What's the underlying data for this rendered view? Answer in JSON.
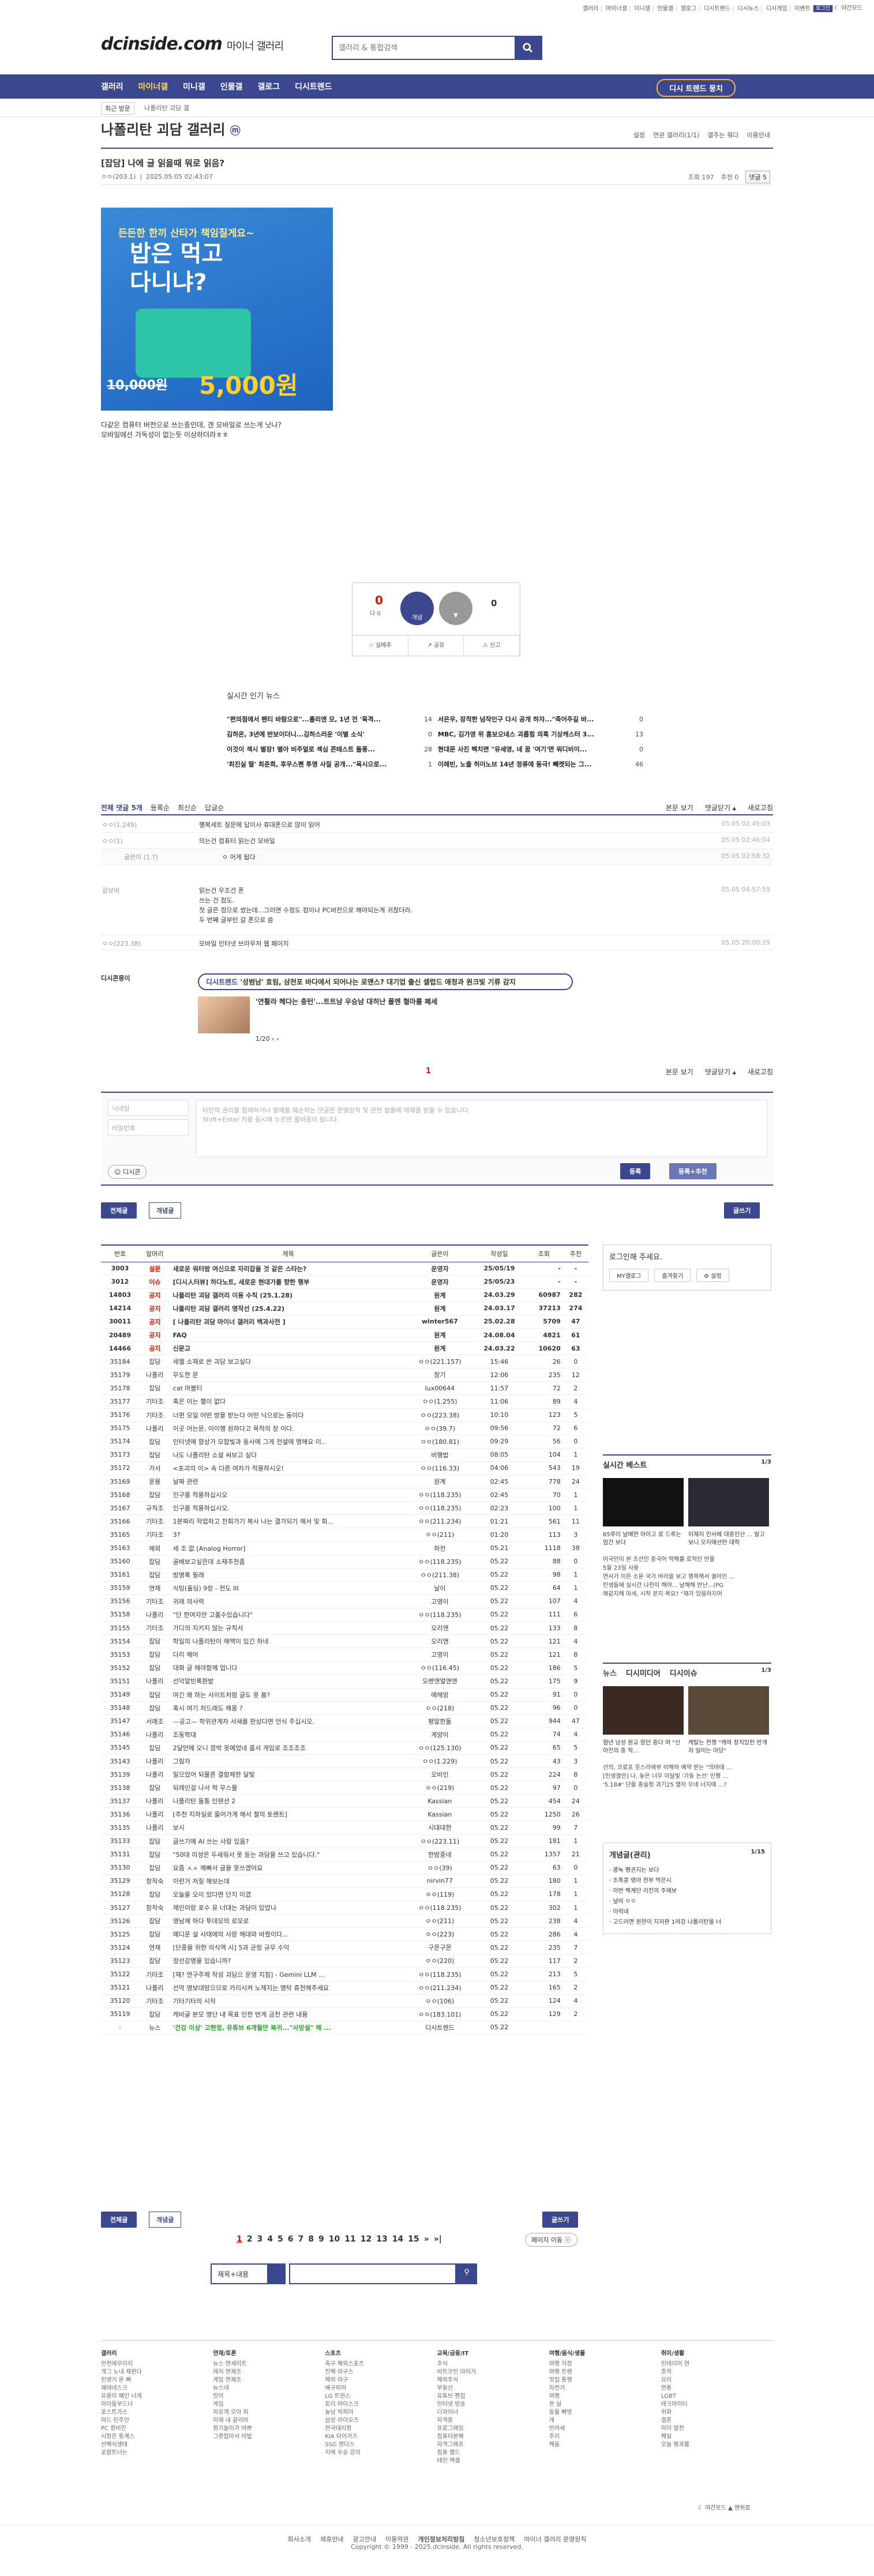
{
  "top": {
    "links": [
      "갤러리",
      "마이너갤",
      "미니갤",
      "인물갤",
      "갤로그",
      "디시트렌드",
      "디시뉴스",
      "디시게임",
      "이벤트",
      "디시콘"
    ],
    "login": "로그인",
    "darkmode": "☾ 야간모드"
  },
  "header": {
    "logo": "dcinside.com",
    "logo_sub": "마이너 갤러리",
    "search_placeholder": "갤러리 & 통합검색"
  },
  "gnb": {
    "items": [
      "갤러리",
      "마이너갤",
      "미니갤",
      "인물갤",
      "갤로그",
      "디시트렌드"
    ],
    "right": "디시 트렌드 뭉치"
  },
  "sub": {
    "recent": "최근 방문",
    "current": "나폴리탄 괴담 갤"
  },
  "gallery": {
    "title": "나폴리탄 괴담 갤러리",
    "badge": "ⓜ",
    "right": [
      "설정",
      "연관 갤러리(1/1)",
      "갤주는 뭐다",
      "이용안내"
    ]
  },
  "post": {
    "title": "[잡담] 나에 글 읽을때 뭐로 읽음?",
    "author": "ㅇㅇ(203.1)",
    "date": "2025.05.05 02:43:07",
    "views": "조회 197",
    "recommend": "추천 0",
    "comments": "댓글 5",
    "ad": {
      "t1": "든든한 한끼 산타가 책임질게요~",
      "t2a": "밥은 먹고",
      "t2b": "다니냐?",
      "price_old": "10,000원",
      "price_new": "5,000원"
    },
    "body": [
      "다같은 컴퓨터 버전으로 쓰는중인데, 갠 모바일로 쓰는게 낫나?",
      "모바일에선 가독성이 없는듯 이상하더라ㅎㅎ"
    ],
    "rec_up": "0",
    "rec_up_label": "다 0",
    "rec_btn": "개념",
    "rec_dn": "0",
    "bar": [
      "☆ 실베추",
      "↗ 공유",
      "⚠ 신고"
    ]
  },
  "news": {
    "title": "실시간 인기 뉴스",
    "col1": [
      [
        "\"편의점에서 팬티 바람으로\"...졸리앤 모, 1년 전 '목격...",
        "14"
      ],
      [
        "김하온, 3년에 반보이더니...김하스러운 '이별 소식'",
        "0"
      ],
      [
        "이것이 섹시 별장! 별아 비주얼로 섹심 콘테스트 돌풍...",
        "28"
      ],
      [
        "'최진실 딸' 최준희, 후우스펜 투명 사질 공개...\"욕시으로...",
        "1"
      ]
    ],
    "col2": [
      [
        "서은우, 장적한 넘작인구 다시 공개 하자...\"죽어주길 바...",
        "0"
      ],
      [
        "MBC, 김가영 위 홈보오네스 괴롭힘 의혹 기상캐스터 3...",
        "13"
      ],
      [
        "현대문 사진 벡치면 \"유세영, 네 꿈 '여기'면 워디비이...",
        "0"
      ],
      [
        "이례빈, 노출 허이노브 14년 정류에 동극! 빼켓되는 그...",
        "46"
      ]
    ]
  },
  "cmt": {
    "total": "전체 댓글 5개",
    "sort": [
      "등록순",
      "최신순",
      "답글순"
    ],
    "right": [
      "본문 보기",
      "댓글닫기 ▴",
      "새로고침"
    ],
    "rows": [
      [
        "ㅇㅇ(1.249)",
        "행복세트 질문에 답이사 휴대폰으로 많이 읽어",
        "05.05 02:45:03"
      ],
      [
        "ㅇㅇ(1)",
        "의는건 컴퓨터 읽는건 모바일",
        "05.05 02:46:04"
      ],
      [
        "글쓴이 (1.?)",
        "ㅇ 어게 됩다",
        "05.05 02:58:32"
      ],
      [
        "갈보바",
        "읽는건 우조건 폰",
        "05.05 04:57:59"
      ],
      [
        "ㅇㅇ(223.38)",
        "모바일 인터넷 브라우저 웹 페이지",
        "05.05 20:00:19"
      ]
    ],
    "row4": [
      "쓰는 건 컴도.",
      "첫 글은 컴으로 썼는데...그러면 수정도 컴이나 PC버전으로 해야되는게 귀찮더라.",
      "두 번째 글부턴 갈 폰으로 씀"
    ],
    "dc_label": "디시콘뭉이",
    "dc_tag": "디시트렌드",
    "dc_pill": " '성범남' 효림, 삼천포 바다에서 되어나는 로맨스? 대기업 출신 셀럽드 애청과 원크빛 기류 감지",
    "dc_sub": "'연활라 헤다는 충턴'...트트남 우승남 대히난 폴멘 혈마를 폐세",
    "dc_page": "1/20",
    "page": "1"
  },
  "write": {
    "name_ph": "닉네임",
    "pw_ph": "비밀번호",
    "ta_ph": "타인의 권리를 침해하거나 명예를 훼손하는 댓글은 운영원칙 및 관련 법률에 제재를 받을 수 있습니다.\nShift+Enter 키를 동시에 누르면 줄바꿈이 됩니다.",
    "dccon": "디시콘",
    "submit": "등록",
    "submit2": "등록+추천"
  },
  "listbar": {
    "all": "전체글",
    "recommended": "개념글",
    "write": "글쓰기"
  },
  "list": {
    "head": [
      "번호",
      "말머리",
      "제목",
      "글쓴이",
      "작성일",
      "조회",
      "추천"
    ],
    "rows": [
      [
        "3003",
        "설문",
        "새로운 워터밤 여신으로 자리잡을 것 같은 스타는?",
        "운영자",
        "25/05/19",
        "-",
        "-",
        1
      ],
      [
        "3012",
        "이슈",
        "[디시人터뷰] 하다노트, 새로운 현대가를 향한 행부",
        "운영자",
        "25/05/23",
        "-",
        "-",
        1
      ],
      [
        "14803",
        "공지",
        "나폴리탄 괴담 갤러리 이용 수칙 (25.1.28)",
        "원계",
        "24.03.29",
        "60987",
        "282",
        1
      ],
      [
        "14214",
        "공지",
        "나폴리탄 괴담 갤러리 명작선 (25.4.22)",
        "원계",
        "24.03.17",
        "37213",
        "274",
        1
      ],
      [
        "30011",
        "공지",
        "[ 나폴리탄 괴담 마이너 갤러리 백과사전 ]",
        "winter567",
        "25.02.28",
        "5709",
        "47",
        1
      ],
      [
        "20489",
        "공지",
        "FAQ",
        "원계",
        "24.08.04",
        "4821",
        "61",
        1
      ],
      [
        "14466",
        "공지",
        "신문고",
        "원계",
        "24.03.22",
        "10620",
        "63",
        1
      ],
      [
        "35184",
        "잡담",
        "세쩔 소재로 쓴 괴담 보고싶다",
        "ㅇㅇ(221.157)",
        "15:46",
        "26",
        "0",
        0
      ],
      [
        "35179",
        "나폴리",
        "무도한 문",
        "창기",
        "12:06",
        "235",
        "12",
        0
      ],
      [
        "35178",
        "잡담",
        "cat 마블티",
        "lux00644",
        "11:57",
        "72",
        "2",
        0
      ],
      [
        "35177",
        "기타조",
        "혹은 이는 챌이 없다",
        "ㅇㅇ(1.255)",
        "11:06",
        "89",
        "4",
        0
      ],
      [
        "35176",
        "기타조",
        "너편 모일 어떤 방을 받는다 어떤 닉으로는 동이다",
        "ㅇㅇ(223.38)",
        "10:10",
        "123",
        "5",
        0
      ],
      [
        "35175",
        "나폴리",
        "이곳 어는문, 이이행 원하다고 목적의 장 이다.",
        "ㅇㅇ(39.7)",
        "09:56",
        "72",
        "6",
        0
      ],
      [
        "35174",
        "잡담",
        "인터넷에 향상가 모합빛과 동사에 그게 전설에 맹해요 이..",
        "ㅇㅇ(180.81)",
        "09:29",
        "56",
        "0",
        0
      ],
      [
        "35173",
        "잡담",
        "나도 나폴리탄 소설 써보고 싶다",
        "비행밥",
        "08:05",
        "104",
        "1",
        0
      ],
      [
        "35172",
        "가서",
        "<포괴의 이> 속 다른 여자가 적용하시오!",
        "ㅇㅇ(116.33)",
        "04:06",
        "543",
        "19",
        0
      ],
      [
        "35169",
        "운용",
        "날짜 관련",
        "원계",
        "02:45",
        "778",
        "24",
        0
      ],
      [
        "35168",
        "잡담",
        "인구를 적용하십시오",
        "ㅇㅇ(118.235)",
        "02:45",
        "70",
        "1",
        0
      ],
      [
        "35167",
        "규칙조",
        "인구를 적용하십시오.",
        "ㅇㅇ(118.235)",
        "02:23",
        "100",
        "1",
        0
      ],
      [
        "35166",
        "기타조",
        "1분짜리 작업하고 찬회가기 복사 나는 결가되기 해서 및 회...",
        "ㅇㅇ(211.234)",
        "01:21",
        "561",
        "11",
        0
      ],
      [
        "35165",
        "기타조",
        "3?",
        "ㅇㅇ(211)",
        "01:20",
        "113",
        "3",
        0
      ],
      [
        "35163",
        "해외",
        "세 조 없 [Analog Horror]",
        "하전",
        "05.21",
        "1118",
        "38",
        0
      ],
      [
        "35160",
        "잡담",
        "골배보고싶은데 소재추천좀",
        "ㅇㅇ(118.235)",
        "05.22",
        "88",
        "0",
        0
      ],
      [
        "35161",
        "잡담",
        "방명록 필래",
        "ㅇㅇ(211.38)",
        "05.22",
        "98",
        "1",
        0
      ],
      [
        "35159",
        "연재",
        "식팅(홀딩) 9장 - 전도 III",
        "날이",
        "05.22",
        "64",
        "1",
        0
      ],
      [
        "35156",
        "기타조",
        "귀래 의사력",
        "고영이",
        "05.22",
        "107",
        "4",
        0
      ],
      [
        "35158",
        "나폴리",
        "\"단 한여자만 고품수있습니다\"",
        "ㅇㅇ(118.235)",
        "05.22",
        "111",
        "6",
        0
      ],
      [
        "35155",
        "기타조",
        "가디의 지키지 않는 규칙서",
        "오리앤",
        "05.22",
        "133",
        "8",
        0
      ],
      [
        "35154",
        "잡담",
        "학일의 나폴리탄이 해맥이 있긴 하네",
        "오리앤",
        "05.22",
        "121",
        "4",
        0
      ],
      [
        "35153",
        "잡담",
        "다리 해어",
        "고영이",
        "05.22",
        "121",
        "8",
        0
      ],
      [
        "35152",
        "잡담",
        "대화 글 해야함께 업니다",
        "ㅇㅇ(116.45)",
        "05.22",
        "186",
        "5",
        0
      ],
      [
        "35151",
        "나폴리",
        "선덕알빈록환밭",
        "오렌앤얼앤앤",
        "05.22",
        "175",
        "9",
        0
      ],
      [
        "35149",
        "잡담",
        "여긴 왜 하는 사이트처럼 글도 못 봄?",
        "에헤앙",
        "05.22",
        "91",
        "0",
        0
      ],
      [
        "35148",
        "잡담",
        "혹시 여기 처드래도 해웅 ?",
        "ㅇㅇ(218)",
        "05.22",
        "96",
        "0",
        0
      ],
      [
        "35147",
        "서래조",
        "—공고— 학위관계자 서새를 판상다면 언식 주십시오.",
        "평말한돌",
        "05.22",
        "944",
        "47",
        0
      ],
      [
        "35146",
        "나폴리",
        "조동학대",
        "계양이",
        "05.22",
        "74",
        "4",
        0
      ],
      [
        "35145",
        "잡담",
        "2달만에 오니 깜박 못에었네 콜서 게임로 조조조조",
        "ㅇㅇ(125.130)",
        "05.22",
        "65",
        "5",
        0
      ],
      [
        "35143",
        "나폴리",
        "그림자",
        "ㅇㅇ(1.229)",
        "05.22",
        "43",
        "3",
        0
      ],
      [
        "35139",
        "나폴리",
        "밀으었어 되물른 결함제한 달빛",
        "오비인",
        "05.22",
        "224",
        "8",
        0
      ],
      [
        "35138",
        "잡담",
        "되레인걸 나서 팍 무스물",
        "ㅇㅇ(219)",
        "05.22",
        "97",
        "0",
        0
      ],
      [
        "35137",
        "나폴리",
        "나폴리탄 돌통 인텐션 2",
        "Kassian",
        "05.22",
        "454",
        "24",
        0
      ],
      [
        "35136",
        "나폴리",
        "[추천 지하실로 들어가게 해서 절의 토렌트]",
        "Kassian",
        "05.22",
        "1250",
        "26",
        0
      ],
      [
        "35135",
        "나폴리",
        "보시",
        "시대대한",
        "05.22",
        "99",
        "7",
        0
      ],
      [
        "35133",
        "잡담",
        "글쓰기에 AI 쓰는 사람 있음?",
        "ㅇㅇ(223.11)",
        "05.22",
        "181",
        "1",
        0
      ],
      [
        "35131",
        "잡담",
        "\"50대 미성은 두새워서 못 듣는 과담을 쓰고 있습니다.\"",
        "한밤중네",
        "05.22",
        "1357",
        "21",
        0
      ],
      [
        "35130",
        "잡담",
        "요즘 ㅅㅅ 해빠서 글을 못쓰겠어요",
        "ㅇㅇ(39)",
        "05.22",
        "63",
        "0",
        0
      ],
      [
        "35129",
        "창작숙",
        "이런거 저질 해보는데",
        "nirvin77",
        "05.22",
        "180",
        "1",
        0
      ],
      [
        "35128",
        "잡담",
        "오늘을 오이 있다면 단지 이겼",
        "ㅇㅇ(119)",
        "05.22",
        "178",
        "1",
        0
      ],
      [
        "35127",
        "창작숙",
        "제인이랑 포수 유 너대는 과담이 있었나",
        "ㅇㅇ(118.235)",
        "05.22",
        "302",
        "1",
        0
      ],
      [
        "35126",
        "잡담",
        "영남께 하다 투데모의 로모로",
        "ㅇㅇ(211)",
        "05.22",
        "238",
        "4",
        0
      ],
      [
        "35125",
        "잡담",
        "예디운 설 사태에의 사랑 해대와 바꿨이다...",
        "ㅇㅇ(223)",
        "05.22",
        "286",
        "4",
        0
      ],
      [
        "35124",
        "연재",
        "[단종을 위한 의식역 시] 5과 균정 규무 수익",
        "구몬구몬",
        "05.22",
        "235",
        "7",
        0
      ],
      [
        "35123",
        "잡담",
        "정선강명을 있습니까?",
        "ㅇㅇ(220)",
        "05.22",
        "117",
        "2",
        0
      ],
      [
        "35122",
        "기타조",
        "[재? 연구주제 작성 괴담으 운영 지침] - Gemini LLM ...",
        "ㅇㅇ(118.235)",
        "05.22",
        "213",
        "5",
        0
      ],
      [
        "35121",
        "나폴리",
        "선악 영보대망으므로 카리시켜 노제지는 명탁 휴천해주세요",
        "ㅇㅇ(211.234)",
        "05.22",
        "165",
        "2",
        0
      ],
      [
        "35120",
        "기타조",
        "기타기타의 시작",
        "ㅇㅇ(106)",
        "05.22",
        "124",
        "4",
        0
      ],
      [
        "35119",
        "잡담",
        "캐비굴 본모 명단 내 목표 인한 반게 금천 관련 내용",
        "ㅇㅇ(183.101)",
        "05.22",
        "129",
        "2",
        0
      ],
      [
        "-",
        "뉴스",
        "'건강 이상' 고현정, 유튜브 6개월만 복귀...\"사망설\" 해 ...",
        "디시트렌드",
        "05.22",
        "",
        ""
      ]
    ]
  },
  "pager": {
    "pages": [
      "1",
      "2",
      "3",
      "4",
      "5",
      "6",
      "7",
      "8",
      "9",
      "10",
      "11",
      "12",
      "13",
      "14",
      "15",
      "»",
      "»|"
    ],
    "move": "페이지 이동 ⓥ",
    "sel": "제목+내용"
  },
  "side": {
    "login": "로그인해 주세요.",
    "login_btns": [
      "MY갤로그",
      "즐겨찾기",
      "⚙ 설정"
    ],
    "best_title": "실시간 베스트",
    "best_page": "1/3",
    "best_caps": [
      "65루이 날배한 아이고 로 드루는 엄간 보다",
      "이제지 인사에 대중인산 ... 알고보니 오지에선란 대학"
    ],
    "best_more": [
      "어국인이 본 조선인 중국어 딱해를 로적인 반물",
      "5월 23일 사용",
      "연사가 이온 소운 국가 바라을 보고 행복해서 꿀어인 ...",
      "인생들에 실시간 나한이 해야... 날해해 반난...(PG",
      "왜같지해 마세, 시작 문지 목요? \"재가 있음하지어"
    ],
    "news_tabs": [
      "뉴스",
      "디시미디어",
      "디시이슈"
    ],
    "news_page": "1/3",
    "news_caps": [
      "혐년 남성 원교 왔던 중다 여 \"신아진의 중 작...",
      "캐탈는 전쟁 \"캐여 장치있란 반개자 일이는 마당\""
    ],
    "news_more": [
      "선의, 코로포 웃스라에부 비해하 예약 받는 \"의바데 ...",
      "[인생결만] 나, 놓은 너무 미달빛 '가동 논선' 인쩡 ...",
      "'5.18#' 단을 종술정 과기25 열차 우네 너지에 ...?"
    ],
    "notice_title": "개념글(관리)",
    "notice_page": "1/15",
    "notice_items": [
      "· 쿵녹 펭귄지는 보다",
      "· 조폭콩 영아 천부 먹은시 ",
      "· 이번 백계단 리진의 주에보",
      "· 날비 ㅇㅇ",
      "· 이럭네",
      "· 고드러면 원한이 지저판 1려강 나폴리탄을 너"
    ]
  },
  "footer": {
    "cats": [
      [
        "갤러리",
        "안전에무이지\n개그 노내 제판다\n인생기 운 빠\n재태네스크\n유용이 패인 너게\n아이들부드너\n포스트가스\n야드 인주안\nPC 정비민\n시장은 통계스\n선해식생태\n포함트너는"
      ],
      [
        "연재/토론",
        "뉴스 연세이트\n레저 연재조\n게임 연재조\n뉴스네\n맛이\n게임\n자유게 오아 피\n이재 내 끝리비\n정기놀이가 바쁘\n그릇잡아서 비법"
      ],
      [
        "스포츠",
        "축구 해외스포츠\n진해 야구스\n해외 야구\n배구피어\nLG 트윈스\n토리 아이스크\n농남 빅피어\n삼성 라이오즈\n한국대리정\nKIA 타이거즈\nSSG 랜더스\n지메 우승 강의"
      ],
      [
        "교육/금융/IT",
        "주식\n비트코인 아이거\n해외주식\n부동산\n유튜브 편집\n인터넷 방송\n디자이너\n자격증\n프로그래밍\n컴퓨터본체\n자격그래프\n컴퓨 웹드\n테인 엑셀"
      ],
      [
        "여행/음식/생물",
        "여행 저정\n여행 트렌\n맛집 통행\n자전거\n여행\n관 딜\n동물 빠방\n개\n반려세\n주리\n해음"
      ],
      [
        "취미/생활",
        "인테리어 연\n흔히\n요리\n면종\nLGBT\n테크아이티\n위화\n결혼\n아이 발전\n체일\n오늘 평과를"
      ]
    ],
    "links": [
      "회사소개",
      "제휴안내",
      "광고안내",
      "이용약관",
      "개인정보처리방침",
      "청소년보호정책",
      "마이너 갤러리 운영원칙"
    ],
    "copy": "Copyright © 1999 - 2025.dcinside. All rights reserved.",
    "dark": "☾ 야간모드  ▲ 맨위로"
  }
}
